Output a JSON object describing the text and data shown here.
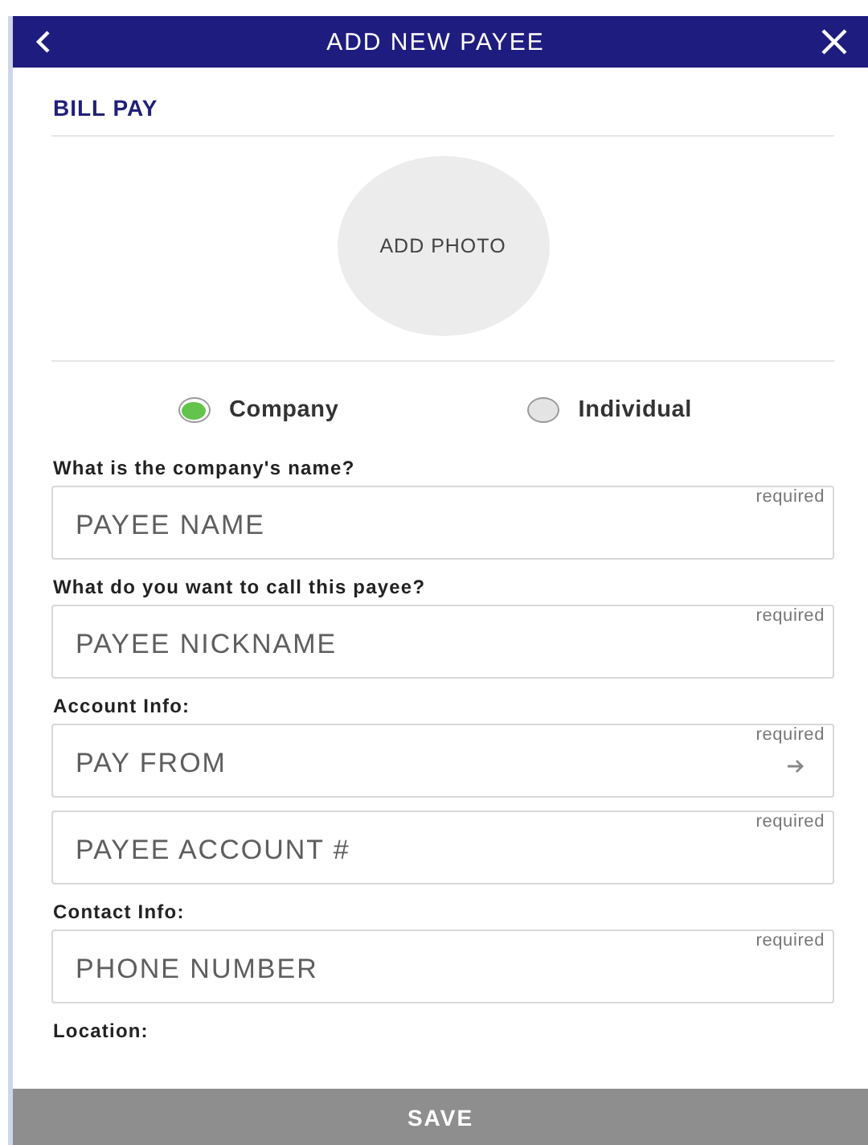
{
  "header": {
    "title": "ADD NEW PAYEE"
  },
  "section_title": "BILL PAY",
  "photo": {
    "label": "ADD PHOTO"
  },
  "payee_types": [
    {
      "label": "Company",
      "selected": true
    },
    {
      "label": "Individual",
      "selected": false
    }
  ],
  "form": [
    {
      "kind": "label",
      "text": "What is the company's name?"
    },
    {
      "kind": "field",
      "placeholder": "PAYEE NAME",
      "hint": "required",
      "arrow": false
    },
    {
      "kind": "label",
      "text": "What do you want to call this payee?"
    },
    {
      "kind": "field",
      "placeholder": "PAYEE NICKNAME",
      "hint": "required",
      "arrow": false
    },
    {
      "kind": "label",
      "text": "Account Info:"
    },
    {
      "kind": "field",
      "placeholder": "PAY FROM",
      "hint": "required",
      "arrow": true
    },
    {
      "kind": "field",
      "placeholder": "PAYEE ACCOUNT #",
      "hint": "required",
      "arrow": false
    },
    {
      "kind": "label",
      "text": "Contact Info:"
    },
    {
      "kind": "field",
      "placeholder": "PHONE NUMBER",
      "hint": "required",
      "arrow": false
    },
    {
      "kind": "label",
      "text": "Location:"
    }
  ],
  "save": {
    "label": "SAVE",
    "disabled": true
  }
}
